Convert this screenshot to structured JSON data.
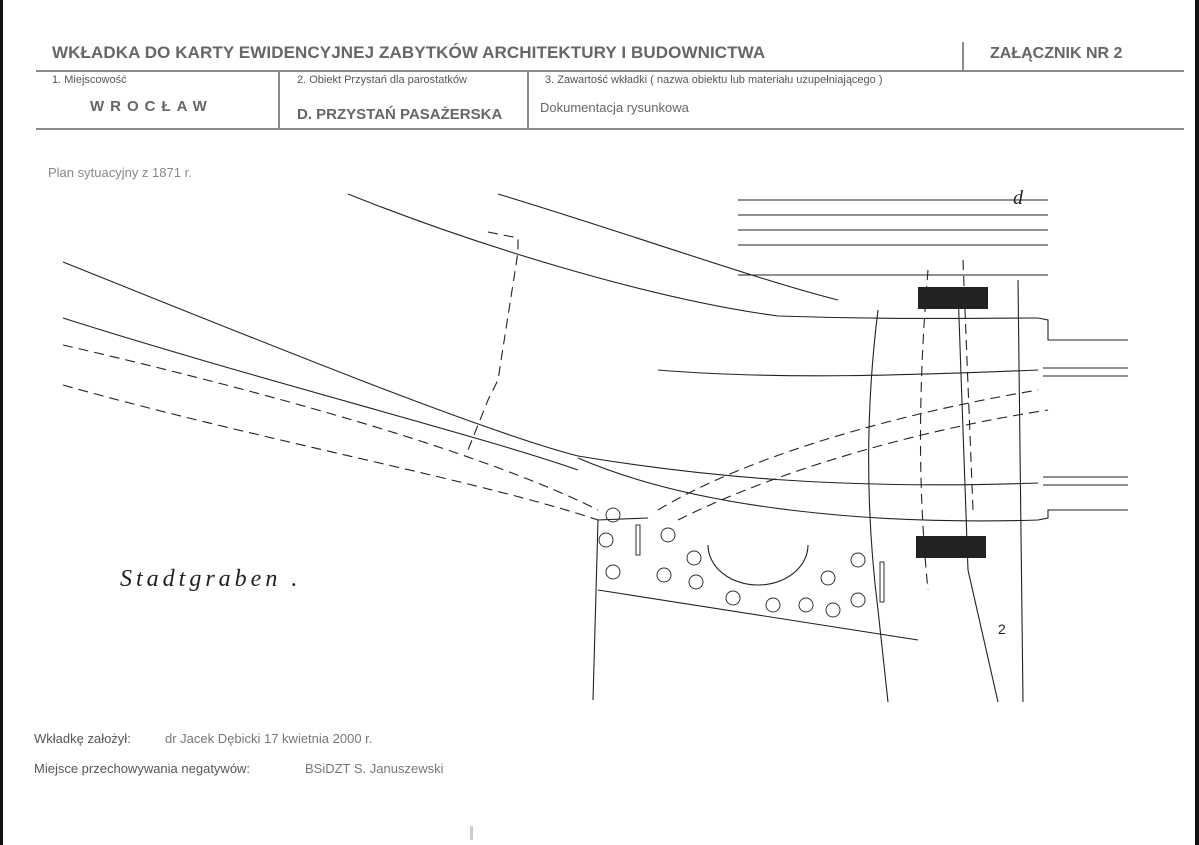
{
  "header": {
    "title": "WKŁADKA DO KARTY EWIDENCYJNEJ ZABYTKÓW ARCHITEKTURY I BUDOWNICTWA",
    "attachment": "ZAŁĄCZNIK NR 2"
  },
  "fields": {
    "place_label": "1. Miejscowość",
    "place_value": "WROCŁAW",
    "object_label": "2. Obiekt  Przystań dla parostatków",
    "object_value": "D. PRZYSTAŃ PASAŻERSKA",
    "contents_label": "3. Zawartość wkładki ( nazwa obiektu lub materiału uzupełniającego )",
    "contents_value": "Dokumentacja rysunkowa"
  },
  "plan": {
    "caption": "Plan sytuacyjny z 1871 r.",
    "label_main": "Stadtgraben .",
    "mark_letter": "d",
    "mark_number": "2"
  },
  "footer": {
    "created_by_label": "Wkładkę założył:",
    "created_by_value": "dr Jacek Dębicki 17 kwietnia 2000 r.",
    "negatives_label": "Miejsce przechowywania negatywów:",
    "negatives_value": "BSiDZT S. Januszewski"
  }
}
